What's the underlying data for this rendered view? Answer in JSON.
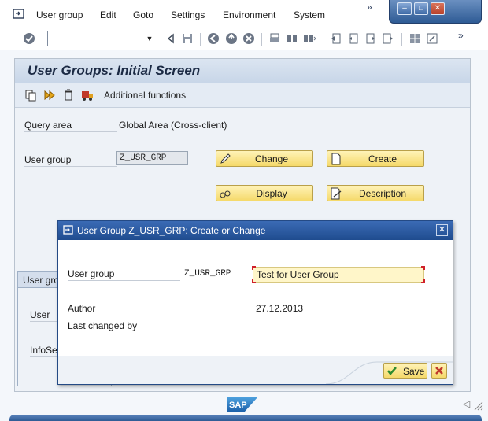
{
  "menu": {
    "items": [
      "User group",
      "Edit",
      "Goto",
      "Settings",
      "Environment",
      "System"
    ],
    "overflow": "»"
  },
  "window_controls": {
    "minimize": "–",
    "maximize": "□",
    "close": "✕"
  },
  "toolbar": {
    "command_field_value": "",
    "overflow": "»",
    "icons": [
      "enter-icon",
      "save-icon",
      "back-icon",
      "exit-icon",
      "cancel-icon",
      "print-icon",
      "find-icon",
      "find-next-icon",
      "first-page-icon",
      "prev-page-icon",
      "next-page-icon",
      "last-page-icon",
      "layout-icon",
      "help-icon"
    ]
  },
  "page": {
    "title": "User Groups: Initial Screen",
    "additional_functions": "Additional functions",
    "query_area_label": "Query area",
    "query_area_value": "Global Area (Cross-client)",
    "user_group_label": "User group",
    "user_group_value": "Z_USR_GRP",
    "buttons": {
      "change": "Change",
      "create": "Create",
      "display": "Display",
      "description": "Description"
    },
    "group_box": {
      "title": "User gro",
      "user_label": "User",
      "infoset_label": "InfoSe"
    }
  },
  "dialog": {
    "title": "User Group Z_USR_GRP: Create or Change",
    "close": "✕",
    "user_group_label": "User group",
    "user_group_value": "Z_USR_GRP",
    "description_value": "Test for User Group",
    "author_label": "Author",
    "author_date": "27.12.2013",
    "last_changed_label": "Last changed by",
    "save_label": "Save"
  },
  "status": {
    "logo": "SAP",
    "arrow": "◁"
  }
}
